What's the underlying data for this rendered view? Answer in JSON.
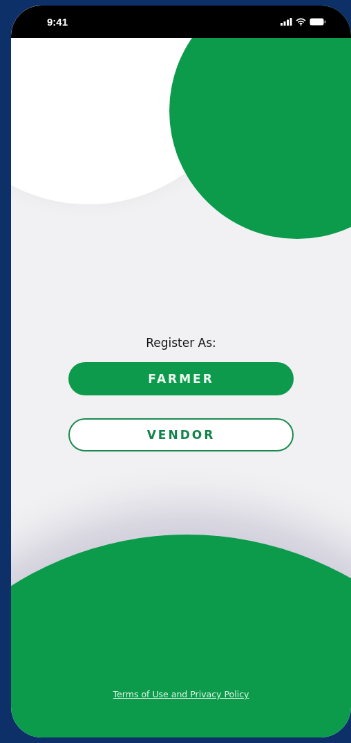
{
  "status_bar": {
    "time": "9:41"
  },
  "prompt": "Register As:",
  "buttons": [
    {
      "label": "FARMER",
      "kind": "filled"
    },
    {
      "label": "VENDOR",
      "kind": "outlined"
    }
  ],
  "footer_link": "Terms of Use and Privacy Policy"
}
